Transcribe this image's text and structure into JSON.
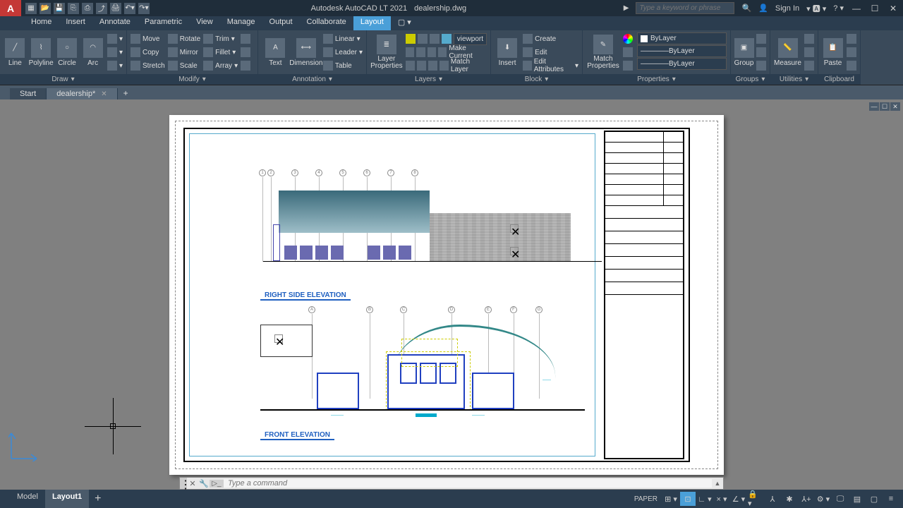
{
  "titlebar": {
    "app": "Autodesk AutoCAD LT 2021",
    "file": "dealership.dwg",
    "search_ph": "Type a keyword or phrase",
    "signin": "Sign In"
  },
  "menu": {
    "tabs": [
      "Home",
      "Insert",
      "Annotate",
      "Parametric",
      "View",
      "Manage",
      "Output",
      "Collaborate",
      "Layout"
    ],
    "active": 8
  },
  "ribbon": {
    "draw": {
      "label": "Draw",
      "line": "Line",
      "polyline": "Polyline",
      "circle": "Circle",
      "arc": "Arc"
    },
    "modify": {
      "label": "Modify",
      "move": "Move",
      "rotate": "Rotate",
      "trim": "Trim",
      "copy": "Copy",
      "mirror": "Mirror",
      "fillet": "Fillet",
      "stretch": "Stretch",
      "scale": "Scale",
      "array": "Array"
    },
    "annotation": {
      "label": "Annotation",
      "text": "Text",
      "dimension": "Dimension",
      "linear": "Linear",
      "leader": "Leader",
      "table": "Table"
    },
    "layers": {
      "label": "Layers",
      "lp": "Layer\nProperties",
      "current": "viewport",
      "make": "Make Current",
      "match": "Match Layer"
    },
    "block": {
      "label": "Block",
      "insert": "Insert",
      "create": "Create",
      "edit": "Edit",
      "attrs": "Edit Attributes"
    },
    "properties": {
      "label": "Properties",
      "match": "Match\nProperties",
      "layer": "ByLayer",
      "lt1": "ByLayer",
      "lt2": "ByLayer"
    },
    "groups": {
      "label": "Groups",
      "group": "Group"
    },
    "utilities": {
      "label": "Utilities",
      "measure": "Measure"
    },
    "clipboard": {
      "label": "Clipboard",
      "paste": "Paste"
    }
  },
  "filetabs": {
    "start": "Start",
    "file": "dealership*"
  },
  "drawing": {
    "title1": "RIGHT SIDE ELEVATION",
    "title2": "FRONT ELEVATION",
    "grid1": [
      "1",
      "2",
      "3",
      "4",
      "5",
      "6",
      "7",
      "8"
    ],
    "grid2": [
      "A",
      "B",
      "C",
      "D",
      "E",
      "F",
      "G"
    ]
  },
  "cmd": {
    "ph": "Type a command"
  },
  "bottom": {
    "model": "Model",
    "layout": "Layout1",
    "space": "PAPER"
  }
}
